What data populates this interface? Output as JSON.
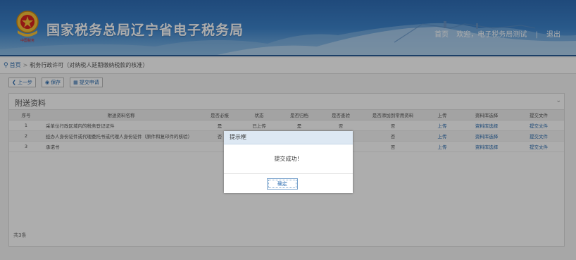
{
  "header": {
    "site_title": "国家税务总局辽宁省电子税务局",
    "emblem_caption": "中国税务",
    "nav": {
      "home": "首页",
      "welcome": "欢迎，电子税务局测试",
      "separator": "|",
      "logout": "退出"
    }
  },
  "breadcrumb": {
    "home": "首页",
    "arrow": ">",
    "current": "税务行政许可（对纳税人延期缴纳税款的核准）"
  },
  "toolbar": {
    "prev": "上一步",
    "save": "保存",
    "next": "提交申请",
    "icons": {
      "prev": "chevron-left-icon",
      "save": "save-icon",
      "next": "submit-icon"
    }
  },
  "panel": {
    "title": "附送资料",
    "collapse_icon": "chevron-down-icon",
    "footer": "共3条",
    "columns": [
      "序号",
      "附送资料名称",
      "是否必报",
      "状态",
      "是否归档",
      "是否查验",
      "是否添加到常用资料",
      "上传",
      "资料库选择",
      "提交文件"
    ],
    "rows": [
      [
        "1",
        "采单位行政区域内的税务登记证件",
        "是",
        "已上传",
        "是",
        "否",
        "否",
        "上传",
        "资料库选择",
        "提交文件"
      ],
      [
        "2",
        "经办人身份证件或代理委托书或代理人身份证件（原件和复印件的核验）",
        "否",
        "",
        "",
        "",
        "否",
        "上传",
        "资料库选择",
        "提交文件"
      ],
      [
        "3",
        "承诺书",
        "",
        "",
        "",
        "",
        "否",
        "上传",
        "资料库选择",
        "提交文件"
      ]
    ]
  },
  "dialog": {
    "title": "提示框",
    "message": "提交成功！",
    "confirm": "确定"
  },
  "colors": {
    "header_blue": "#3d84cc",
    "link_blue": "#2b6cb0",
    "dialog_title_bg": "#dde8f3"
  }
}
